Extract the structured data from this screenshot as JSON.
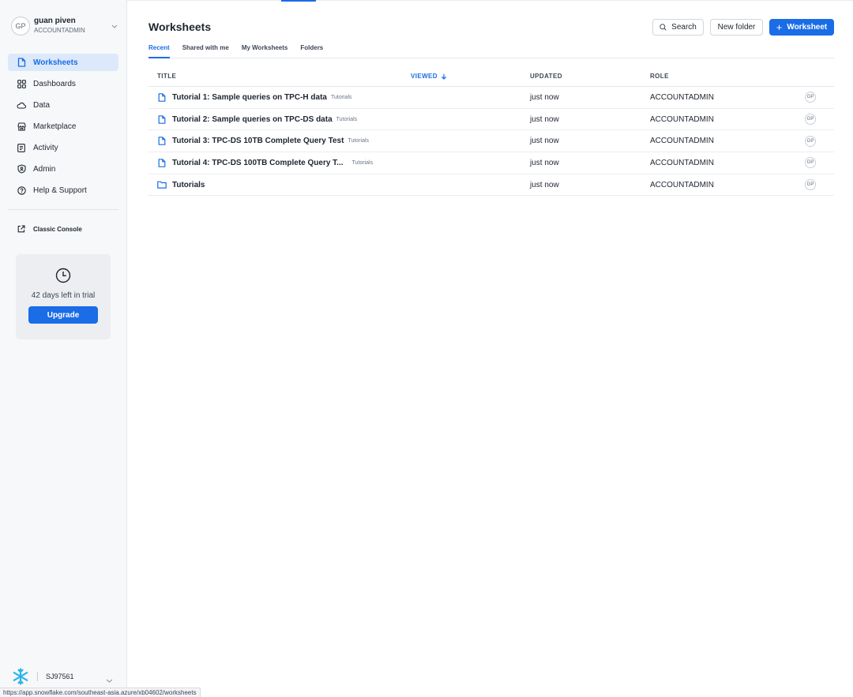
{
  "user": {
    "initials": "GP",
    "name": "guan piven",
    "role": "ACCOUNTADMIN"
  },
  "sidebar": {
    "items": [
      {
        "label": "Worksheets",
        "icon": "worksheet-icon",
        "active": true
      },
      {
        "label": "Dashboards",
        "icon": "dashboard-grid-icon",
        "active": false
      },
      {
        "label": "Data",
        "icon": "cloud-icon",
        "active": false
      },
      {
        "label": "Marketplace",
        "icon": "store-icon",
        "active": false
      },
      {
        "label": "Activity",
        "icon": "activity-icon",
        "active": false
      },
      {
        "label": "Admin",
        "icon": "shield-icon",
        "active": false
      },
      {
        "label": "Help & Support",
        "icon": "help-icon",
        "active": false
      }
    ],
    "classic_console": "Classic Console",
    "trial": {
      "text": "42 days left in trial",
      "upgrade_label": "Upgrade"
    },
    "account": "SJ97561"
  },
  "header": {
    "title": "Worksheets",
    "search_label": "Search",
    "new_folder_label": "New folder",
    "new_worksheet_label": "Worksheet"
  },
  "tabs": [
    {
      "label": "Recent",
      "active": true
    },
    {
      "label": "Shared with me",
      "active": false
    },
    {
      "label": "My Worksheets",
      "active": false
    },
    {
      "label": "Folders",
      "active": false
    }
  ],
  "table": {
    "columns": {
      "title": "TITLE",
      "viewed": "VIEWED",
      "updated": "UPDATED",
      "role": "ROLE"
    },
    "rows": [
      {
        "type": "worksheet",
        "title": "Tutorial 1: Sample queries on TPC-H data",
        "folder": "Tutorials",
        "viewed": "",
        "updated": "just now",
        "role": "ACCOUNTADMIN",
        "owner": "GP"
      },
      {
        "type": "worksheet",
        "title": "Tutorial 2: Sample queries on TPC-DS data",
        "folder": "Tutorials",
        "viewed": "",
        "updated": "just now",
        "role": "ACCOUNTADMIN",
        "owner": "GP"
      },
      {
        "type": "worksheet",
        "title": "Tutorial 3: TPC-DS 10TB Complete Query Test",
        "folder": "Tutorials",
        "viewed": "",
        "updated": "just now",
        "role": "ACCOUNTADMIN",
        "owner": "GP"
      },
      {
        "type": "worksheet",
        "title": "Tutorial 4: TPC-DS 100TB Complete Query T...",
        "folder": "Tutorials",
        "viewed": "",
        "updated": "just now",
        "role": "ACCOUNTADMIN",
        "owner": "GP"
      },
      {
        "type": "folder",
        "title": "Tutorials",
        "folder": "",
        "viewed": "",
        "updated": "just now",
        "role": "ACCOUNTADMIN",
        "owner": "GP"
      }
    ]
  },
  "status_url": "https://app.snowflake.com/southeast-asia.azure/xb04602/worksheets",
  "colors": {
    "accent": "#1a6ce7",
    "active_bg": "#dce9fb",
    "sidebar_bg": "#f7f8fa",
    "snowflake": "#29b5e8"
  }
}
